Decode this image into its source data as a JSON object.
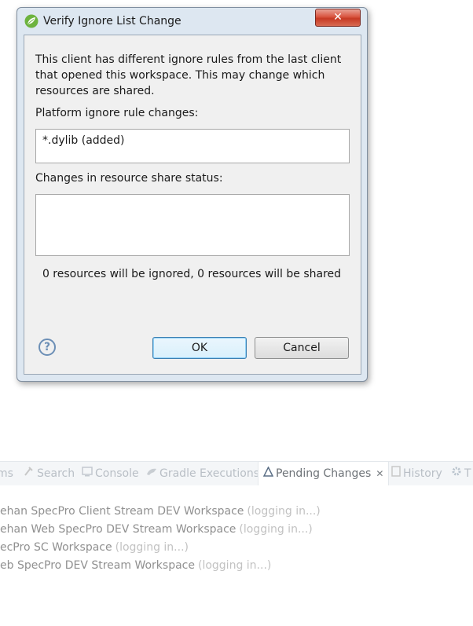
{
  "dialog": {
    "title": "Verify Ignore List Change",
    "close_label": "✕",
    "message": "This client has different ignore rules from the last client that opened this workspace. This may change which resources are shared.",
    "platform_label": "Platform ignore rule changes:",
    "platform_changes": [
      "*.dylib (added)"
    ],
    "share_label": "Changes in resource share status:",
    "share_changes": [],
    "summary": "0 resources will be ignored, 0 resources will be shared",
    "help_label": "?",
    "ok_label": "OK",
    "cancel_label": "Cancel"
  },
  "workbench": {
    "tabs": [
      {
        "label": "ms",
        "icon": ""
      },
      {
        "label": "Search",
        "icon": "search-icon"
      },
      {
        "label": "Console",
        "icon": "console-icon"
      },
      {
        "label": "Gradle Executions",
        "icon": "gradle-icon"
      },
      {
        "label": "Pending Changes",
        "icon": "pending-changes-icon",
        "active": true
      },
      {
        "label": "History",
        "icon": "history-icon"
      },
      {
        "label": "T",
        "icon": "gear-icon"
      }
    ],
    "workspaces": [
      {
        "name": "ehan SpecPro Client Stream DEV Workspace",
        "status": "(logging in...)"
      },
      {
        "name": "ehan Web SpecPro DEV Stream Workspace",
        "status": "(logging in...)"
      },
      {
        "name": "ecPro SC Workspace",
        "status": "(logging in...)"
      },
      {
        "name": "eb SpecPro DEV Stream Workspace",
        "status": "(logging in...)"
      }
    ]
  }
}
